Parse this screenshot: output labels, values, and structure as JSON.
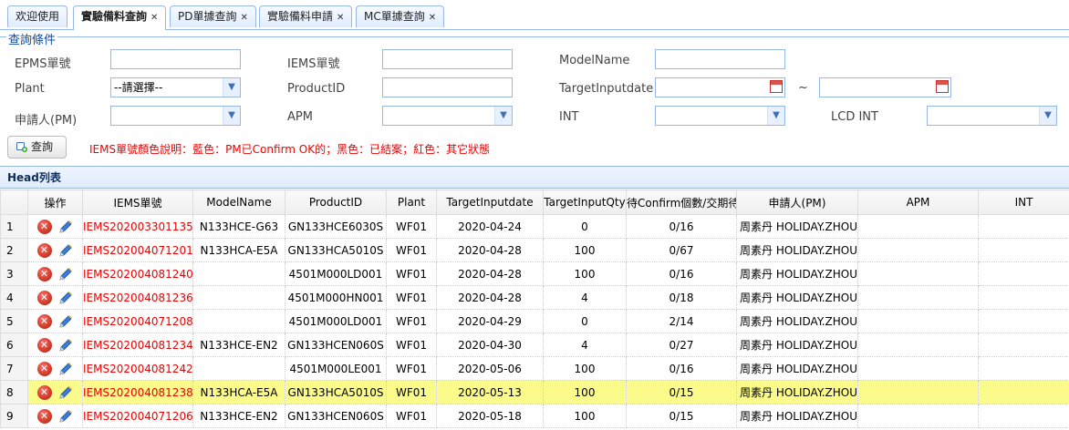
{
  "tabs": [
    {
      "label": "欢迎使用",
      "closable": false,
      "active": false
    },
    {
      "label": "實驗備料查詢",
      "closable": true,
      "active": true
    },
    {
      "label": "PD單據查詢",
      "closable": true,
      "active": false
    },
    {
      "label": "實驗備料申請",
      "closable": true,
      "active": false
    },
    {
      "label": "MC單據查詢",
      "closable": true,
      "active": false
    }
  ],
  "query": {
    "legend": "查詢條件",
    "fields": {
      "epms_no": {
        "label": "EPMS單號",
        "value": ""
      },
      "iems_no": {
        "label": "IEMS單號",
        "value": ""
      },
      "model_name": {
        "label": "ModelName",
        "value": ""
      },
      "plant": {
        "label": "Plant",
        "value": "--請選擇--"
      },
      "product_id": {
        "label": "ProductID",
        "value": ""
      },
      "target_input_date": {
        "label": "TargetInputdate",
        "from": "",
        "to": "",
        "separator": "~"
      },
      "applicant": {
        "label": "申請人(PM)",
        "value": ""
      },
      "apm": {
        "label": "APM",
        "value": ""
      },
      "int": {
        "label": "INT",
        "value": ""
      },
      "lcd_int": {
        "label": "LCD INT",
        "value": ""
      }
    },
    "search_button": "查詢",
    "color_note": "IEMS單號顏色說明：藍色：PM已Confirm OK的；黑色：已結案；紅色：其它狀態"
  },
  "grid": {
    "title": "Head列表",
    "columns": [
      "操作",
      "IEMS單號",
      "ModelName",
      "ProductID",
      "Plant",
      "TargetInputdate",
      "TargetInputQty",
      "待Confirm個數/交期待",
      "申請人(PM)",
      "APM",
      "INT"
    ],
    "rows": [
      {
        "n": "1",
        "iems": "IEMS202003301135",
        "model": "N133HCE-G63",
        "product": "GN133HCE6030S",
        "plant": "WF01",
        "date": "2020-04-24",
        "qty": "0",
        "confirm": "0/16",
        "pm": "周素丹 HOLIDAY.ZHOU",
        "apm": "",
        "int": "",
        "highlight": false
      },
      {
        "n": "2",
        "iems": "IEMS202004071201",
        "model": "N133HCA-E5A",
        "product": "GN133HCA5010S",
        "plant": "WF01",
        "date": "2020-04-28",
        "qty": "100",
        "confirm": "0/67",
        "pm": "周素丹 HOLIDAY.ZHOU",
        "apm": "",
        "int": "",
        "highlight": false
      },
      {
        "n": "3",
        "iems": "IEMS202004081240",
        "model": "",
        "product": "4501M000LD001",
        "plant": "WF01",
        "date": "2020-04-28",
        "qty": "100",
        "confirm": "0/16",
        "pm": "周素丹 HOLIDAY.ZHOU",
        "apm": "",
        "int": "",
        "highlight": false
      },
      {
        "n": "4",
        "iems": "IEMS202004081236",
        "model": "",
        "product": "4501M000HN001",
        "plant": "WF01",
        "date": "2020-04-28",
        "qty": "4",
        "confirm": "0/18",
        "pm": "周素丹 HOLIDAY.ZHOU",
        "apm": "",
        "int": "",
        "highlight": false
      },
      {
        "n": "5",
        "iems": "IEMS202004071208",
        "model": "",
        "product": "4501M000LD001",
        "plant": "WF01",
        "date": "2020-04-29",
        "qty": "0",
        "confirm": "2/14",
        "pm": "周素丹 HOLIDAY.ZHOU",
        "apm": "",
        "int": "",
        "highlight": false
      },
      {
        "n": "6",
        "iems": "IEMS202004081234",
        "model": "N133HCE-EN2",
        "product": "GN133HCEN060S",
        "plant": "WF01",
        "date": "2020-04-30",
        "qty": "4",
        "confirm": "0/27",
        "pm": "周素丹 HOLIDAY.ZHOU",
        "apm": "",
        "int": "",
        "highlight": false
      },
      {
        "n": "7",
        "iems": "IEMS202004081242",
        "model": "",
        "product": "4501M000LE001",
        "plant": "WF01",
        "date": "2020-05-06",
        "qty": "100",
        "confirm": "0/16",
        "pm": "周素丹 HOLIDAY.ZHOU",
        "apm": "",
        "int": "",
        "highlight": false
      },
      {
        "n": "8",
        "iems": "IEMS202004081238",
        "model": "N133HCA-E5A",
        "product": "GN133HCA5010S",
        "plant": "WF01",
        "date": "2020-05-13",
        "qty": "100",
        "confirm": "0/15",
        "pm": "周素丹 HOLIDAY.ZHOU",
        "apm": "",
        "int": "",
        "highlight": true
      },
      {
        "n": "9",
        "iems": "IEMS202004071206",
        "model": "N133HCE-EN2",
        "product": "GN133HCEN060S",
        "plant": "WF01",
        "date": "2020-05-18",
        "qty": "100",
        "confirm": "0/15",
        "pm": "周素丹 HOLIDAY.ZHOU",
        "apm": "",
        "int": "",
        "highlight": false
      }
    ]
  },
  "colors": {
    "accent": "#95b8e7",
    "status_red": "#e00000",
    "highlight_row": "#fbfb8c",
    "legend_blue": "#0e4a9f"
  },
  "icons": {
    "delete": "delete-circle-icon",
    "edit": "pencil-icon",
    "calendar": "calendar-icon",
    "search": "search-add-icon",
    "dropdown": "chevron-down-icon"
  }
}
